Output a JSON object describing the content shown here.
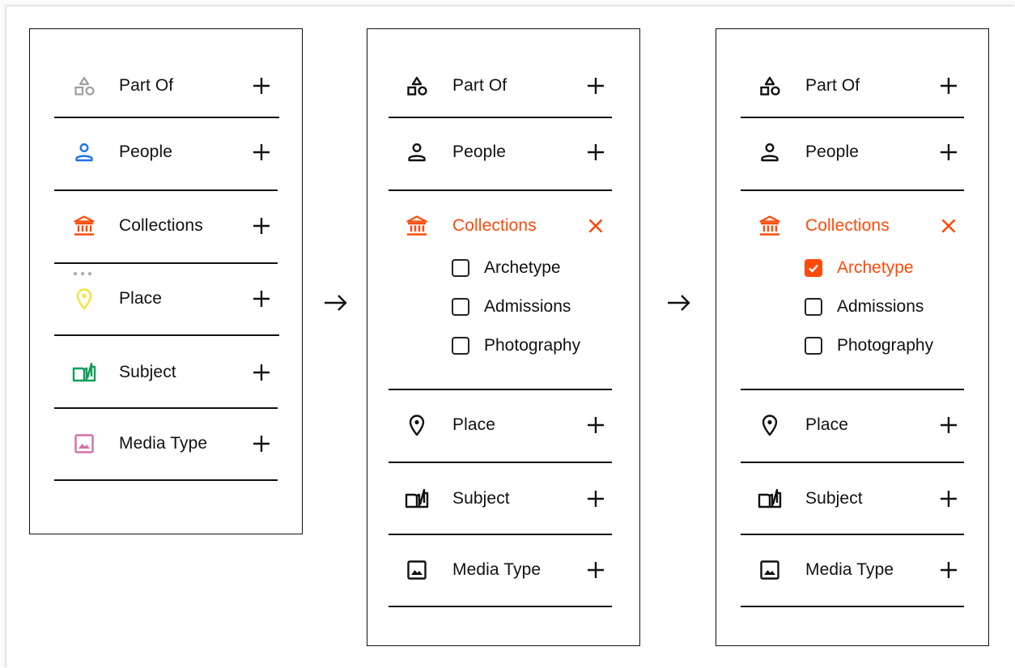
{
  "filters": {
    "part_of": "Part Of",
    "people": "People",
    "collections": "Collections",
    "place": "Place",
    "subject": "Subject",
    "media_type": "Media Type"
  },
  "collections_options": [
    "Archetype",
    "Admissions",
    "Photography"
  ],
  "states": {
    "panel_1": {
      "expanded": "none",
      "icon_style": "colored"
    },
    "panel_2": {
      "expanded": "collections",
      "icon_style": "mono",
      "checked": []
    },
    "panel_3": {
      "expanded": "collections",
      "icon_style": "mono",
      "checked": [
        "Archetype"
      ]
    }
  },
  "icons": {
    "part_of": "shapes-icon",
    "people": "person-icon",
    "collections": "museum-icon",
    "place": "location-pin-icon",
    "subject": "open-book-icon",
    "media_type": "image-icon",
    "add": "plus-icon",
    "close": "close-x-icon",
    "transition": "arrow-right-icon",
    "drag": "drag-dots-icon"
  },
  "colors": {
    "accent": "#ff4a0a",
    "part_of_icon": "#9e9e9e",
    "people_icon": "#1a73e8",
    "collections_icon": "#ff4a0a",
    "place_icon": "#f2e33a",
    "subject_icon": "#0f9d58",
    "media_type_icon": "#d66fa6",
    "mono_icon": "#111111"
  }
}
